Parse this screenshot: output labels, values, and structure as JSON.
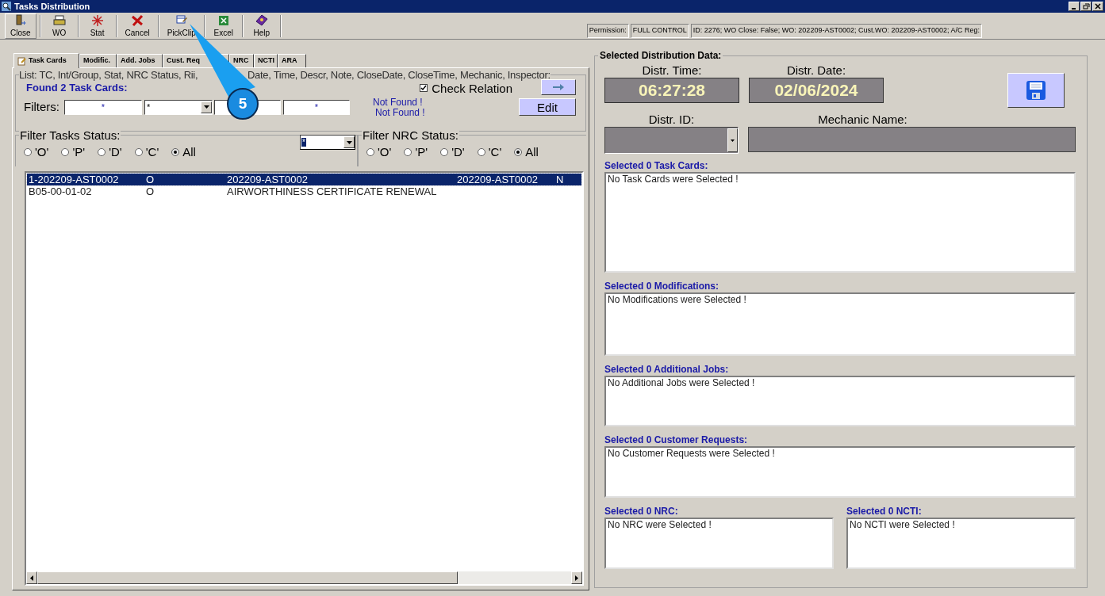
{
  "window": {
    "title": "Tasks Distribution"
  },
  "toolbar": [
    {
      "label": "Close",
      "kind": "door"
    },
    {
      "label": "WO",
      "kind": "printer"
    },
    {
      "label": "Stat",
      "kind": "star"
    },
    {
      "label": "Cancel",
      "kind": "cross"
    },
    {
      "label": "PickClip",
      "kind": "clip"
    },
    {
      "label": "Excel",
      "kind": "sheet"
    },
    {
      "label": "Help",
      "kind": "book"
    }
  ],
  "status": {
    "permission_label": "Permission:",
    "permission": "FULL CONTROL",
    "info": "ID: 2276; WO Close: False; WO: 202209-AST0002; Cust.WO: 202209-AST0002; A/C Reg:"
  },
  "tabs": [
    {
      "label": "Task Cards",
      "selected": true
    },
    {
      "label": "Modific.",
      "selected": false
    },
    {
      "label": "Add. Jobs",
      "selected": false
    },
    {
      "label": "Cust. Req",
      "selected": false
    },
    {
      "label": "NRC",
      "selected": false
    },
    {
      "label": "NCTI",
      "selected": false
    },
    {
      "label": "ARA",
      "selected": false
    }
  ],
  "list": {
    "caption_start": "List: TC, Int/Group, Stat, NRC Status, Rii,",
    "caption_end": "Date, Time, Descr, Note, CloseDate, CloseTime, Mechanic, Inspector:",
    "found": "Found 2 Task Cards:",
    "check_relation": {
      "label": "Check Relation",
      "checked": true
    },
    "filters_label": "Filters:",
    "filters": [
      {
        "kind": "text",
        "value": "*"
      },
      {
        "kind": "combo",
        "value": "*"
      },
      {
        "kind": "text"
      },
      {
        "kind": "text",
        "value": "*"
      }
    ],
    "not_found": [
      "Not Found !",
      "Not Found !"
    ],
    "edit": "Edit"
  },
  "task_status": {
    "label": "Filter Tasks Status:",
    "options": [
      {
        "label": "'O'",
        "selected": false
      },
      {
        "label": "'P'",
        "selected": false
      },
      {
        "label": "'D'",
        "selected": false
      },
      {
        "label": "'C'",
        "selected": false
      },
      {
        "label": "All",
        "selected": true
      }
    ],
    "combo": "*"
  },
  "nrc_status": {
    "label": "Filter NRC Status:",
    "options": [
      {
        "label": "'O'",
        "selected": false
      },
      {
        "label": "'P'",
        "selected": false
      },
      {
        "label": "'D'",
        "selected": false
      },
      {
        "label": "'C'",
        "selected": false
      },
      {
        "label": "All",
        "selected": true
      }
    ]
  },
  "rows": [
    {
      "selected": true,
      "cells": [
        "1-202209-AST0002",
        "O",
        "202209-AST0002",
        "202209-AST0002",
        "N"
      ]
    },
    {
      "selected": false,
      "cells": [
        "B05-00-01-02",
        "O",
        "AIRWORTHINESS CERTIFICATE RENEWAL"
      ]
    }
  ],
  "distribution": {
    "title": "Selected Distribution Data:",
    "time_label": "Distr. Time:",
    "time": "06:27:28",
    "date_label": "Distr. Date:",
    "date": "02/06/2024",
    "id_label": "Distr. ID:",
    "mechanic_label": "Mechanic Name:"
  },
  "sections": [
    {
      "title": "Selected 0 Task Cards:",
      "text": "No Task Cards were Selected !"
    },
    {
      "title": "Selected 0 Modifications:",
      "text": "No Modifications were Selected !"
    },
    {
      "title": "Selected 0 Additional Jobs:",
      "text": "No Additional Jobs were Selected !"
    },
    {
      "title": "Selected 0 Customer Requests:",
      "text": "No Customer Requests were Selected !"
    },
    {
      "title": "Selected 0 NRC:",
      "text": "No NRC were Selected !"
    },
    {
      "title": "Selected 0 NCTI:",
      "text": "No NCTI were Selected !"
    }
  ],
  "callout": {
    "label": "5"
  }
}
